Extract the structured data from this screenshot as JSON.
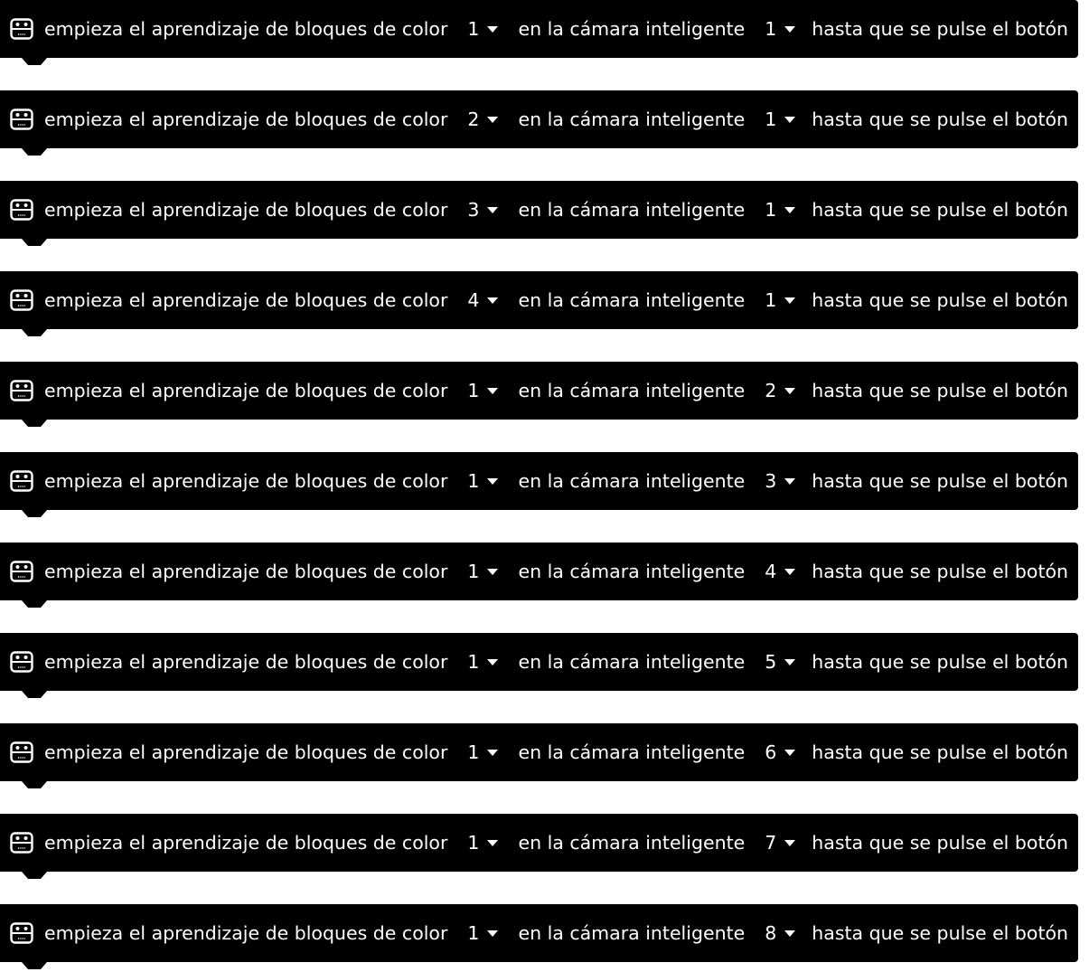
{
  "blocks": [
    {
      "text_start": "empieza el aprendizaje de bloques de color",
      "color_block": "1",
      "text_mid": "en la cámara inteligente",
      "camera": "1",
      "text_end": "hasta que se pulse el botón"
    },
    {
      "text_start": "empieza el aprendizaje de bloques de color",
      "color_block": "2",
      "text_mid": "en la cámara inteligente",
      "camera": "1",
      "text_end": "hasta que se pulse el botón"
    },
    {
      "text_start": "empieza el aprendizaje de bloques de color",
      "color_block": "3",
      "text_mid": "en la cámara inteligente",
      "camera": "1",
      "text_end": "hasta que se pulse el botón"
    },
    {
      "text_start": "empieza el aprendizaje de bloques de color",
      "color_block": "4",
      "text_mid": "en la cámara inteligente",
      "camera": "1",
      "text_end": "hasta que se pulse el botón"
    },
    {
      "text_start": "empieza el aprendizaje de bloques de color",
      "color_block": "1",
      "text_mid": "en la cámara inteligente",
      "camera": "2",
      "text_end": "hasta que se pulse el botón"
    },
    {
      "text_start": "empieza el aprendizaje de bloques de color",
      "color_block": "1",
      "text_mid": "en la cámara inteligente",
      "camera": "3",
      "text_end": "hasta que se pulse el botón"
    },
    {
      "text_start": "empieza el aprendizaje de bloques de color",
      "color_block": "1",
      "text_mid": "en la cámara inteligente",
      "camera": "4",
      "text_end": "hasta que se pulse el botón"
    },
    {
      "text_start": "empieza el aprendizaje de bloques de color",
      "color_block": "1",
      "text_mid": "en la cámara inteligente",
      "camera": "5",
      "text_end": "hasta que se pulse el botón"
    },
    {
      "text_start": "empieza el aprendizaje de bloques de color",
      "color_block": "1",
      "text_mid": "en la cámara inteligente",
      "camera": "6",
      "text_end": "hasta que se pulse el botón"
    },
    {
      "text_start": "empieza el aprendizaje de bloques de color",
      "color_block": "1",
      "text_mid": "en la cámara inteligente",
      "camera": "7",
      "text_end": "hasta que se pulse el botón"
    },
    {
      "text_start": "empieza el aprendizaje de bloques de color",
      "color_block": "1",
      "text_mid": "en la cámara inteligente",
      "camera": "8",
      "text_end": "hasta que se pulse el botón"
    }
  ],
  "icon": "robot-face-icon",
  "colors": {
    "block_bg": "#000000",
    "text": "#ffffff",
    "page_bg": "#ffffff"
  }
}
